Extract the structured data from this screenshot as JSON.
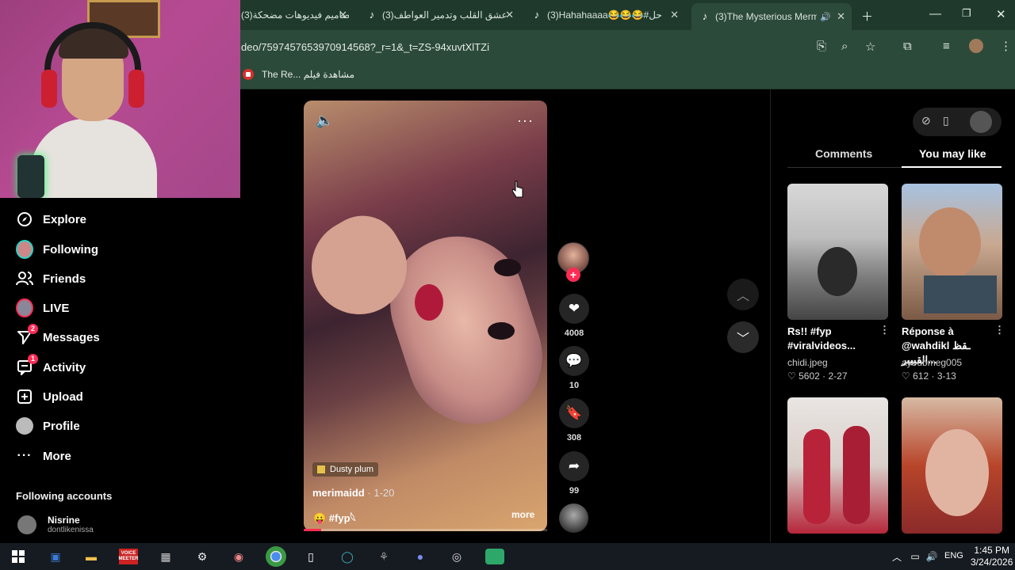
{
  "browser": {
    "tabs": [
      {
        "title": "(3)تصاميم فيديوهات مضحكة"
      },
      {
        "title": "(3)عشق القلب وتدمير العواطف"
      },
      {
        "title": "(3)Hahahaaaa😂😂😂#حل"
      },
      {
        "title": "(3)The Mysterious Merm"
      }
    ],
    "url": "deo/7597457653970914568?_r=1&_t=ZS-94xuvtXlTZi",
    "bookmark": "The Re... مشاهدة فيلم"
  },
  "sidebar": {
    "items": [
      {
        "label": "Explore",
        "icon": "compass-icon"
      },
      {
        "label": "Following",
        "icon": "avatar-icon"
      },
      {
        "label": "Friends",
        "icon": "friends-icon"
      },
      {
        "label": "LIVE",
        "icon": "live-icon"
      },
      {
        "label": "Messages",
        "icon": "send-icon",
        "badge": "2"
      },
      {
        "label": "Activity",
        "icon": "activity-icon",
        "badge": "1"
      },
      {
        "label": "Upload",
        "icon": "upload-icon"
      },
      {
        "label": "Profile",
        "icon": "profile-icon"
      },
      {
        "label": "More",
        "icon": "more-icon"
      }
    ],
    "following_header": "Following accounts",
    "account": {
      "name": "Nisrine",
      "username": "dontlikenissa"
    }
  },
  "video": {
    "music": "Dusty plum",
    "author": "merimaidd",
    "date": "· 1-20",
    "caption": "😛 #fyp𓆩",
    "more": "more",
    "likes": "4008",
    "comments": "10",
    "saves": "308",
    "shares": "99"
  },
  "panel": {
    "tabs": [
      "Comments",
      "You may like"
    ],
    "videos": [
      {
        "title": "Rs!! #fyp #viralvideos...",
        "user": "chidi.jpeg",
        "likes": "5602",
        "date": "2-27"
      },
      {
        "title": "Réponse à @wahdikl ـقظ القبيبر...",
        "user": "ayoubmeg005",
        "likes": "612",
        "date": "3-13"
      }
    ]
  },
  "taskbar": {
    "time": "1:45 PM",
    "date": "3/24/2026",
    "lang": "ENG",
    "voice_label": "VOICE\nMEETER"
  },
  "colors": {
    "accent": "#fe2c55",
    "chrome": "#2c4a3a",
    "tabbar": "#1f3a2c"
  }
}
